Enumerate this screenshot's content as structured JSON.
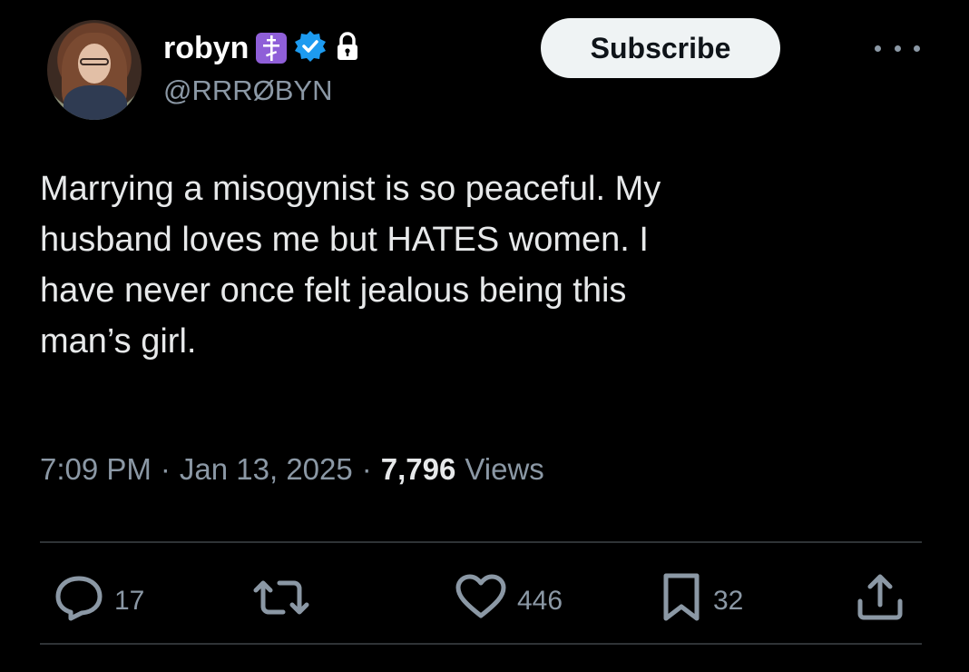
{
  "author": {
    "display_name": "robyn",
    "handle": "@RRRØBYN",
    "badges": [
      "orthodox-cross-icon",
      "verified-badge-icon",
      "lock-icon"
    ]
  },
  "subscribe_label": "Subscribe",
  "tweet": {
    "text": "Marrying a misogynist is so peaceful. My\nhusband loves me but HATES women. I\nhave never once felt jealous being this\nman’s girl."
  },
  "meta": {
    "time": "7:09 PM",
    "separator": "·",
    "date": "Jan 13, 2025",
    "views_count": "7,796",
    "views_label": "Views"
  },
  "actions": {
    "reply_count": "17",
    "retweet_count": "",
    "like_count": "446",
    "bookmark_count": "32"
  },
  "colors": {
    "background": "#000000",
    "text": "#e7e9ea",
    "secondary_text": "#8b98a5",
    "verified_blue": "#1d9bf0",
    "badge_purple": "#8f5fd8",
    "divider": "#2f3336"
  }
}
